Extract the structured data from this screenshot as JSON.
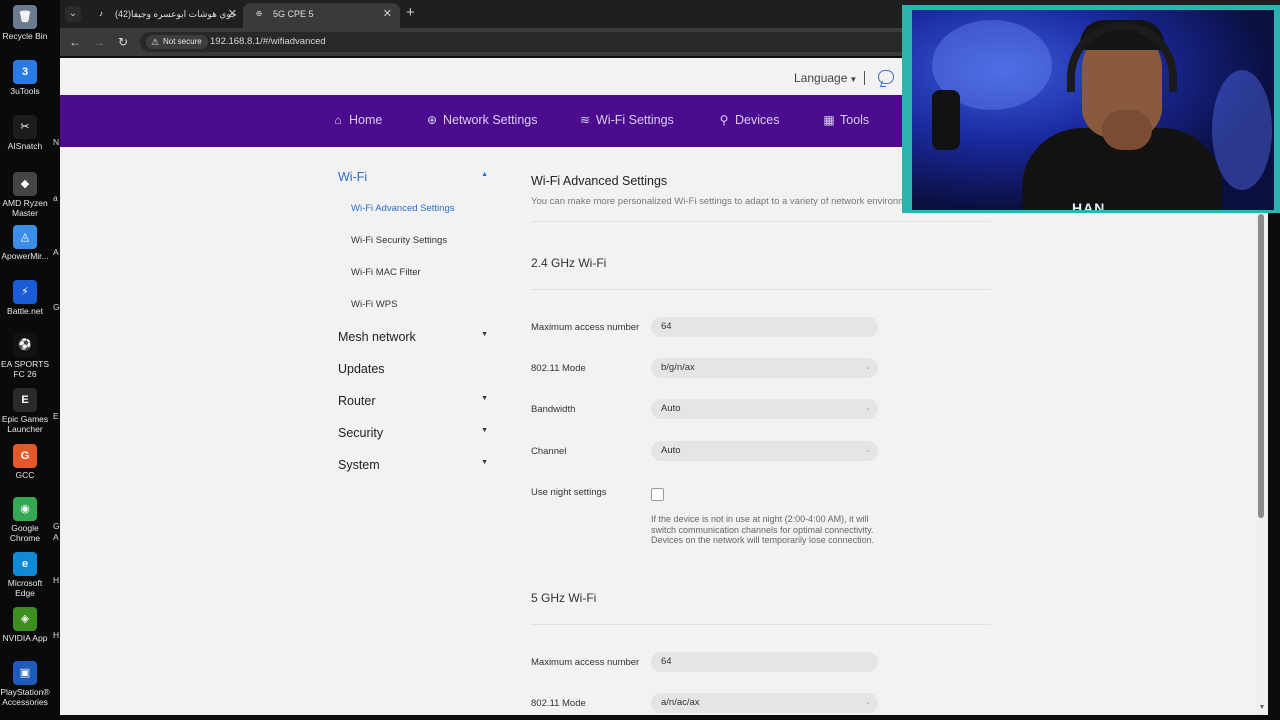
{
  "desktop": {
    "icons": [
      {
        "label": "Recycle Bin",
        "icon": "recycle-bin-icon",
        "color": "#6b7a8c",
        "glyph": "🗑"
      },
      {
        "label": "3uTools",
        "icon": "3utools-icon",
        "color": "#2a7be4",
        "glyph": "3"
      },
      {
        "label": "AISnatch",
        "icon": "aisnatch-icon",
        "color": "#1c1c1c",
        "glyph": "✂"
      },
      {
        "label": "AMD Ryzen Master",
        "icon": "amd-ryzen-master-icon",
        "color": "#444444",
        "glyph": "◆"
      },
      {
        "label": "ApowerMir...",
        "icon": "apowermirror-icon",
        "color": "#3a8ee6",
        "glyph": "◬"
      },
      {
        "label": "Battle.net",
        "icon": "battlenet-icon",
        "color": "#1a5bd6",
        "glyph": "⚡"
      },
      {
        "label": "EA SPORTS FC 26",
        "icon": "ea-sports-fc-icon",
        "color": "#111111",
        "glyph": "⚽"
      },
      {
        "label": "Epic Games Launcher",
        "icon": "epic-games-icon",
        "color": "#2a2a2a",
        "glyph": "E"
      },
      {
        "label": "GCC",
        "icon": "gcc-icon",
        "color": "#e05a2a",
        "glyph": "G"
      },
      {
        "label": "Google Chrome",
        "icon": "chrome-icon",
        "color": "#34a853",
        "glyph": "◉"
      },
      {
        "label": "Microsoft Edge",
        "icon": "edge-icon",
        "color": "#0f8bd6",
        "glyph": "e"
      },
      {
        "label": "NVIDIA App",
        "icon": "nvidia-icon",
        "color": "#3c8f1e",
        "glyph": "◈"
      },
      {
        "label": "PlayStation® Accessories",
        "icon": "playstation-icon",
        "color": "#1f5bb8",
        "glyph": "▣"
      }
    ],
    "cut_labels": [
      "N",
      "a",
      "A",
      "G",
      "E",
      "G",
      "A",
      "H",
      "H"
    ]
  },
  "browser": {
    "tabs": [
      {
        "title": "(42)جوي هوشات ابوعسره وجيفا",
        "icon": "tiktok-icon",
        "active": false
      },
      {
        "title": "5G CPE 5",
        "icon": "globe-icon",
        "active": true
      }
    ],
    "security_label": "Not secure",
    "url": "192.168.8.1/#/wifiadvanced"
  },
  "page": {
    "language_label": "Language",
    "nav": [
      {
        "label": "Home",
        "icon": "home-icon",
        "glyph": "⌂"
      },
      {
        "label": "Network Settings",
        "icon": "globe-icon",
        "glyph": "⊕"
      },
      {
        "label": "Wi-Fi Settings",
        "icon": "wifi-icon",
        "glyph": "≋"
      },
      {
        "label": "Devices",
        "icon": "devices-icon",
        "glyph": "⚲"
      },
      {
        "label": "Tools",
        "icon": "tools-icon",
        "glyph": "▦"
      }
    ],
    "sidebar": {
      "wifi_label": "Wi-Fi",
      "wifi_sub": [
        "Wi-Fi Advanced Settings",
        "Wi-Fi Security Settings",
        "Wi-Fi MAC Filter",
        "Wi-Fi WPS"
      ],
      "others": [
        {
          "label": "Mesh network",
          "caret": true
        },
        {
          "label": "Updates",
          "caret": false
        },
        {
          "label": "Router",
          "caret": true
        },
        {
          "label": "Security",
          "caret": true
        },
        {
          "label": "System",
          "caret": true
        }
      ]
    },
    "content": {
      "title": "Wi-Fi Advanced Settings",
      "description": "You can make more personalized Wi-Fi settings to adapt to a variety of network environments.",
      "band24": {
        "heading": "2.4 GHz Wi-Fi",
        "max_access_label": "Maximum access number",
        "max_access_value": "64",
        "mode_label": "802.11 Mode",
        "mode_value": "b/g/n/ax",
        "bandwidth_label": "Bandwidth",
        "bandwidth_value": "Auto",
        "channel_label": "Channel",
        "channel_value": "Auto",
        "night_label": "Use night settings",
        "night_checked": false,
        "night_hint": "If the device is not in use at night (2:00-4:00 AM), it will switch communication channels for optimal connectivity. Devices on the network will temporarily lose connection."
      },
      "band5": {
        "heading": "5 GHz Wi-Fi",
        "max_access_label": "Maximum access number",
        "max_access_value": "64",
        "mode_label": "802.11 Mode",
        "mode_value": "a/n/ac/ax"
      }
    }
  },
  "webcam": {
    "logo_text": "HAN"
  },
  "colors": {
    "nav_purple": "#4a0b8f",
    "link_blue": "#2a6fcf",
    "webcam_border": "#2bb3b0"
  }
}
